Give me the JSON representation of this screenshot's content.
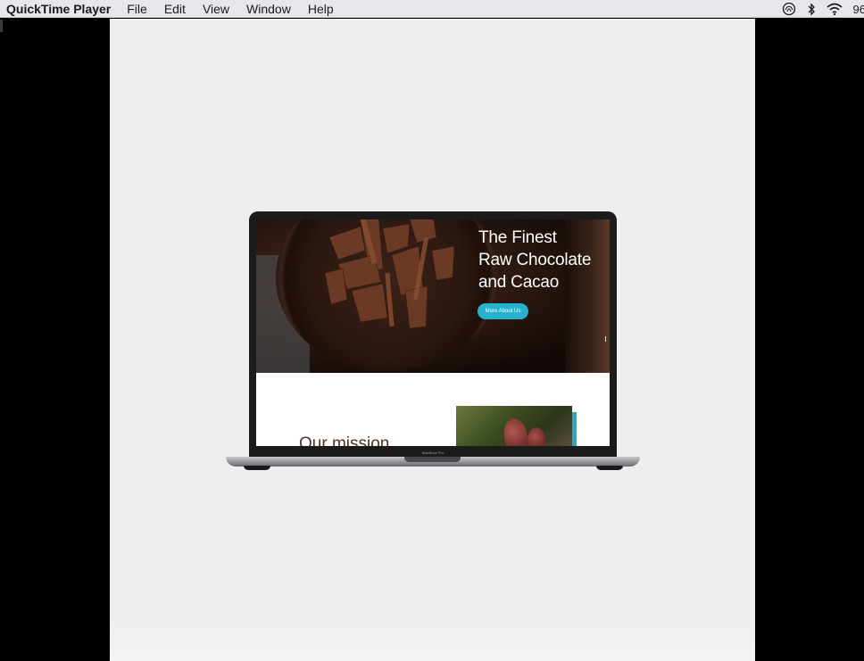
{
  "menubar": {
    "app_name": "QuickTime Player",
    "menus": [
      "File",
      "Edit",
      "View",
      "Window",
      "Help"
    ],
    "battery_text": "96"
  },
  "website": {
    "hero_title_lines": [
      "The Finest",
      "Raw Chocolate",
      "and Cacao"
    ],
    "hero_button": "More About Us",
    "section_heading": "Our mission"
  },
  "laptop": {
    "model_label": "MacBook Pro"
  },
  "colors": {
    "accent": "#26b2cf",
    "menubar_bg": "#e8e6ea",
    "canvas_bg": "#efeded"
  }
}
